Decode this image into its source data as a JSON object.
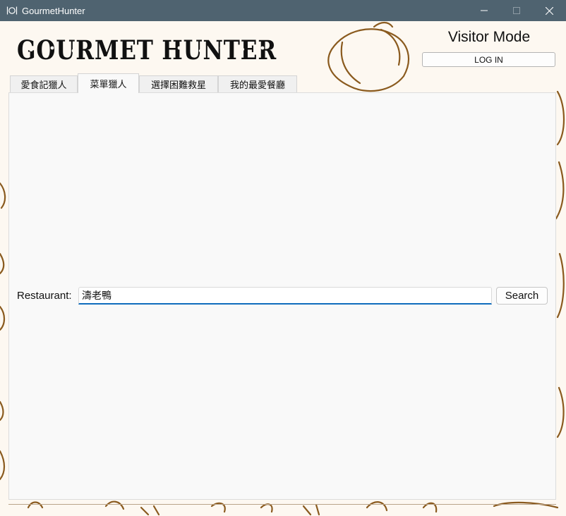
{
  "window": {
    "title": "GourmetHunter",
    "app_icon": "fork-knife-plate-icon",
    "controls": [
      "minimize-icon",
      "maximize-icon",
      "close-icon"
    ]
  },
  "header": {
    "logo_text": "GOURMET HUNTER",
    "mode_label": "Visitor Mode",
    "login_label": "LOG IN"
  },
  "tabs": [
    {
      "label": "愛食記獵人",
      "active": false
    },
    {
      "label": "菜單獵人",
      "active": true
    },
    {
      "label": "選擇困難救星",
      "active": false
    },
    {
      "label": "我的最愛餐廳",
      "active": false
    }
  ],
  "search": {
    "label": "Restaurant:",
    "value": "濤老鴨",
    "button_label": "Search"
  },
  "colors": {
    "titlebar": "#4f6370",
    "background": "#fdf8f1",
    "doodle_stroke": "#8a5a1e",
    "input_focus": "#0f6cbd"
  }
}
